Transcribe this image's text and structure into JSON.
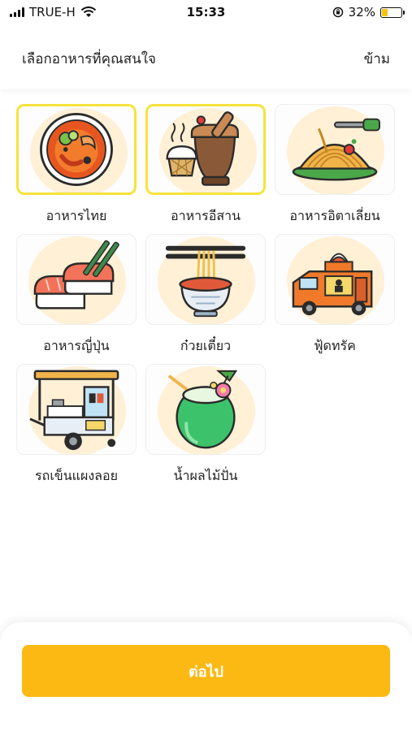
{
  "status_bar": {
    "carrier": "TRUE-H",
    "time": "15:33",
    "battery_percent": "32%",
    "battery_level": 0.32,
    "battery_color": "#f6c40f"
  },
  "header": {
    "title": "เลือกอาหารที่คุณสนใจ",
    "skip_label": "ข้าม"
  },
  "categories": [
    {
      "label": "อาหารไทย",
      "icon": "thai-curry-bowl-icon",
      "selected": true
    },
    {
      "label": "อาหารอีสาน",
      "icon": "mortar-sticky-rice-icon",
      "selected": true
    },
    {
      "label": "อาหารอิตาเลี่ยน",
      "icon": "spaghetti-fork-icon",
      "selected": false
    },
    {
      "label": "อาหารญี่ปุ่น",
      "icon": "sushi-chopsticks-icon",
      "selected": false
    },
    {
      "label": "ก๋วยเตี๋ยว",
      "icon": "noodle-bowl-icon",
      "selected": false
    },
    {
      "label": "ฟู้ดทรัค",
      "icon": "food-truck-icon",
      "selected": false
    },
    {
      "label": "รถเข็นแผงลอย",
      "icon": "street-food-cart-icon",
      "selected": false
    },
    {
      "label": "น้ำผลไม้ปั่น",
      "icon": "coconut-drink-icon",
      "selected": false
    }
  ],
  "footer": {
    "next_label": "ต่อไป",
    "button_color": "#fdb913"
  },
  "colors": {
    "selected_border": "#f6e33c",
    "card_glow": "#fff0d6"
  }
}
